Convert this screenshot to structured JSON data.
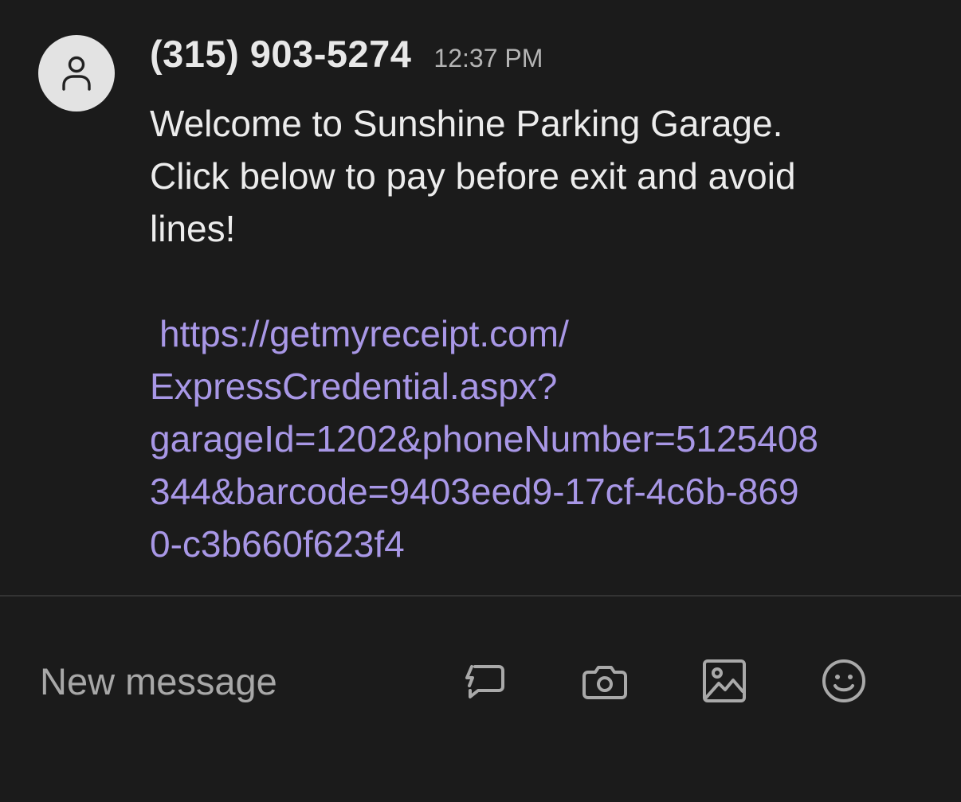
{
  "message": {
    "avatar_icon": "person-icon",
    "sender": "(315) 903-5274",
    "time": "12:37 PM",
    "body_lines": [
      "Welcome to Sunshine Parking Garage.",
      "Click below to pay before exit and avoid",
      "lines!"
    ],
    "link_lines": [
      "https://getmyreceipt.com/",
      "ExpressCredential.aspx?",
      "garageId=1202&phoneNumber=5125408",
      "344&barcode=9403eed9-17cf-4c6b-869",
      "0-c3b660f623f4"
    ],
    "link_color": "#a897e6"
  },
  "composer": {
    "placeholder": "New message",
    "icons": [
      "quick-reply-icon",
      "camera-icon",
      "image-icon",
      "emoji-icon"
    ]
  }
}
